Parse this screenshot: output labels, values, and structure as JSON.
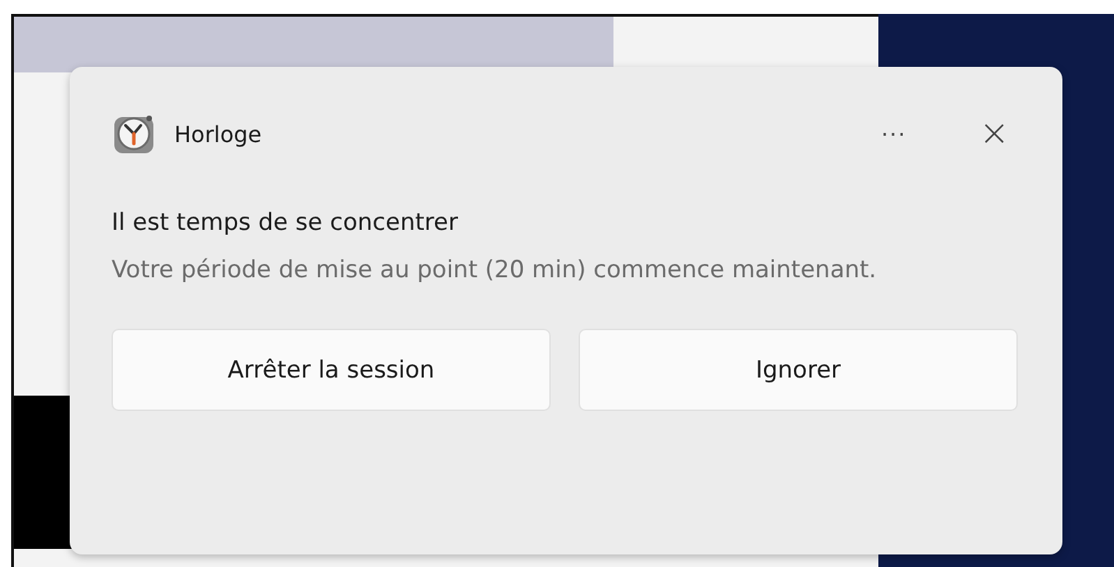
{
  "notification": {
    "app_name": "Horloge",
    "more_label": "···",
    "close_label": "×",
    "title": "Il est temps de se concentrer",
    "message": "Votre période de mise au point (20 min) commence maintenant.",
    "buttons": [
      "Arrêter la session",
      "Ignorer"
    ]
  }
}
